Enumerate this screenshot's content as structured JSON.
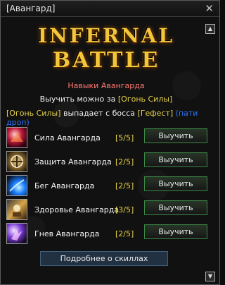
{
  "window": {
    "title": "[Авангард]",
    "close_symbol": "✕",
    "scroll_up_symbol": "▲",
    "scroll_down_symbol": "▼"
  },
  "logo": {
    "line1": "INFERNAL",
    "line2": "BATTLE"
  },
  "info": {
    "section_title": "Навыки Авангарда",
    "learn_prefix": "Выучить можно за ",
    "learn_item": "[Огонь Силы]",
    "drop_item": "[Огонь Силы]",
    "drop_text": " выпадает с босса ",
    "drop_boss": "[Гефест]",
    "drop_party": "(пати дроп)"
  },
  "skills": [
    {
      "name": "Сила Авангарда",
      "level": "[5/5]",
      "button": "Выучить",
      "icon": "strength-skill-icon"
    },
    {
      "name": "Защита Авангарда",
      "level": "[2/5]",
      "button": "Выучить",
      "icon": "defense-skill-icon"
    },
    {
      "name": "Бег Авангарда",
      "level": "[2/5]",
      "button": "Выучить",
      "icon": "run-skill-icon"
    },
    {
      "name": "Здоровье Авангарда",
      "level": "[3/5]",
      "button": "Выучить",
      "icon": "health-skill-icon"
    },
    {
      "name": "Гнев Авангарда",
      "level": "[2/5]",
      "button": "Выучить",
      "icon": "wrath-skill-icon"
    }
  ],
  "more_button": "Подробнее о скиллах",
  "colors": {
    "accent_title": "#ff7a73",
    "item_yellow": "#e6d24a",
    "party_blue": "#2d74ff",
    "button_green_border": "#3a8a44"
  }
}
